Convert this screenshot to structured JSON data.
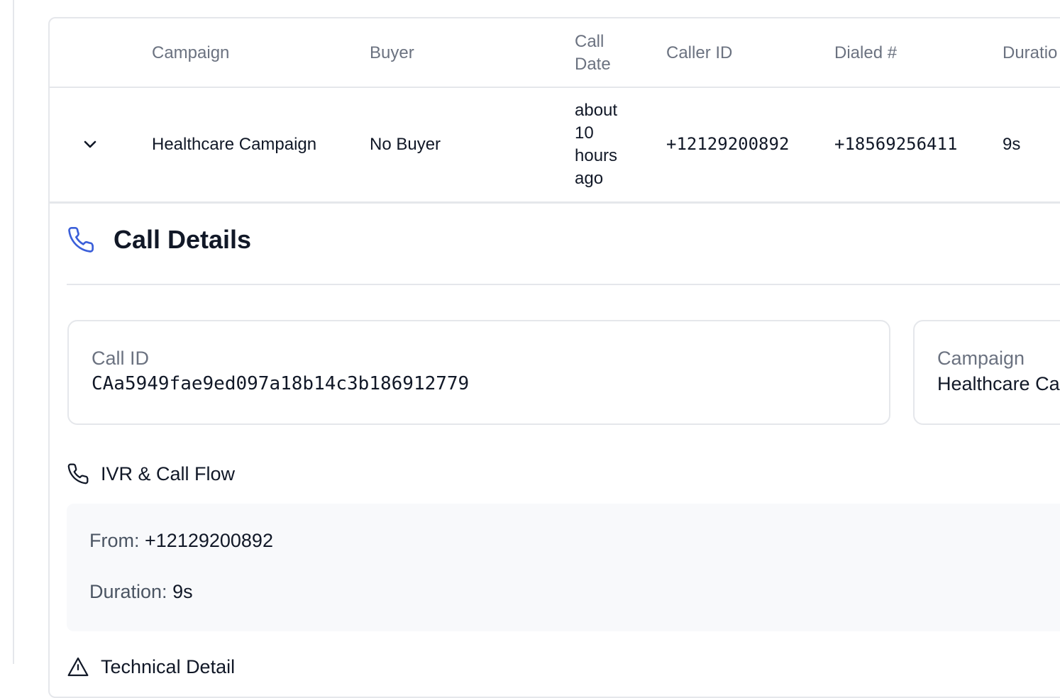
{
  "table": {
    "headers": {
      "campaign": "Campaign",
      "buyer": "Buyer",
      "call_date_line1": "Call",
      "call_date_line2": "Date",
      "caller_id": "Caller ID",
      "dialed": "Dialed #",
      "duration": "Duratio"
    },
    "row": {
      "campaign": "Healthcare Campaign",
      "buyer": "No Buyer",
      "call_date_lines": [
        "about",
        "10",
        "hours",
        "ago"
      ],
      "caller_id": "+12129200892",
      "dialed": "+18569256411",
      "duration": "9s"
    }
  },
  "details": {
    "title": "Call Details",
    "call_id_label": "Call ID",
    "call_id_value": "CAa5949fae9ed097a18b14c3b186912779",
    "campaign_label": "Campaign",
    "campaign_value": "Healthcare Ca",
    "ivr_title": "IVR & Call Flow",
    "from_label": "From:",
    "from_value": "+12129200892",
    "duration_label": "Duration:",
    "duration_value": "9s",
    "technical_title": "Technical Detail"
  },
  "colors": {
    "accent": "#3b5fd9",
    "border": "#e5e7eb",
    "muted_text": "#6b7280",
    "panel_bg": "#f8f9fb"
  },
  "icons": {
    "expand": "chevron-down-icon",
    "details": "phone-icon",
    "ivr": "phone-icon",
    "technical": "warning-icon"
  }
}
